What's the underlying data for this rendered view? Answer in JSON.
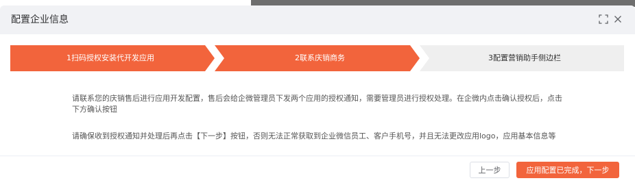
{
  "dialog": {
    "title": "配置企业信息",
    "fullscreen_icon": "fullscreen-icon",
    "close_icon": "close-icon"
  },
  "steps": [
    {
      "label": "1扫码授权安装代开发应用",
      "state": "active"
    },
    {
      "label": "2联系庆销商务",
      "state": "active"
    },
    {
      "label": "3配置营销助手侧边栏",
      "state": "inactive"
    }
  ],
  "content": {
    "paragraph1": "请联系您的庆销售后进行应用开发配置，售后会给企微管理员下发两个应用的授权通知，需要管理员进行授权处理。在企微内点击确认授权后，点击下方确认按钮",
    "paragraph2": "请确保收到授权通知并处理后再点击【下一步】按钮，否则无法正常获取到企业微信员工、客户手机号，并且无法更改应用logo，应用基本信息等"
  },
  "footer": {
    "prev_label": "上一步",
    "next_label": "应用配置已完成，下一步"
  },
  "colors": {
    "accent": "#f2643c",
    "step_inactive": "#efefef",
    "header_bg": "#f1f2f5"
  }
}
